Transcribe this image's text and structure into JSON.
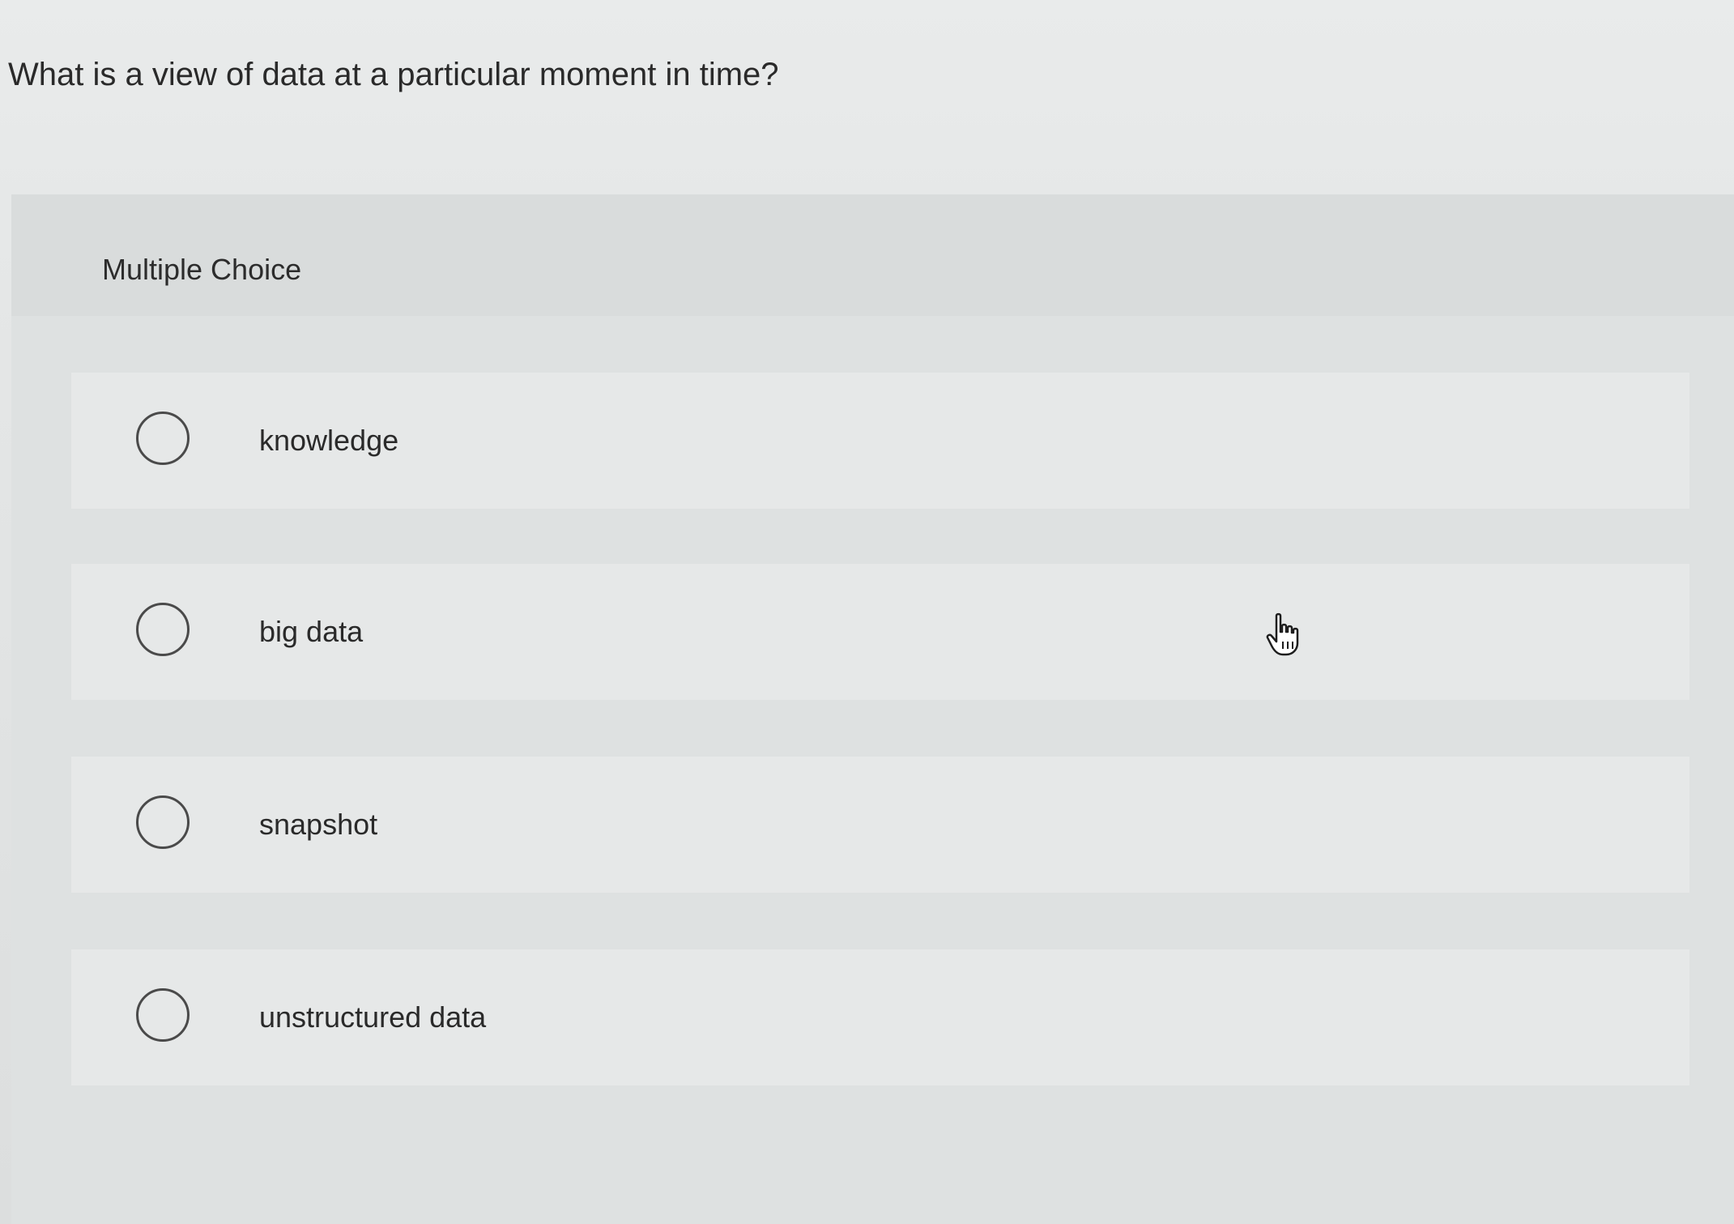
{
  "question": {
    "text": "What is a view of data at a particular moment in time?"
  },
  "answer_panel": {
    "type_label": "Multiple Choice",
    "options": [
      {
        "label": "knowledge",
        "selected": false
      },
      {
        "label": "big data",
        "selected": false
      },
      {
        "label": "snapshot",
        "selected": false
      },
      {
        "label": "unstructured data",
        "selected": false
      }
    ]
  },
  "pointer": {
    "icon": "hand-pointer-icon"
  },
  "colors": {
    "background": "#e4e6e6",
    "option_background": "#e6e8e8",
    "radio_border": "#4a4a4a",
    "text": "#2a2a2a"
  }
}
